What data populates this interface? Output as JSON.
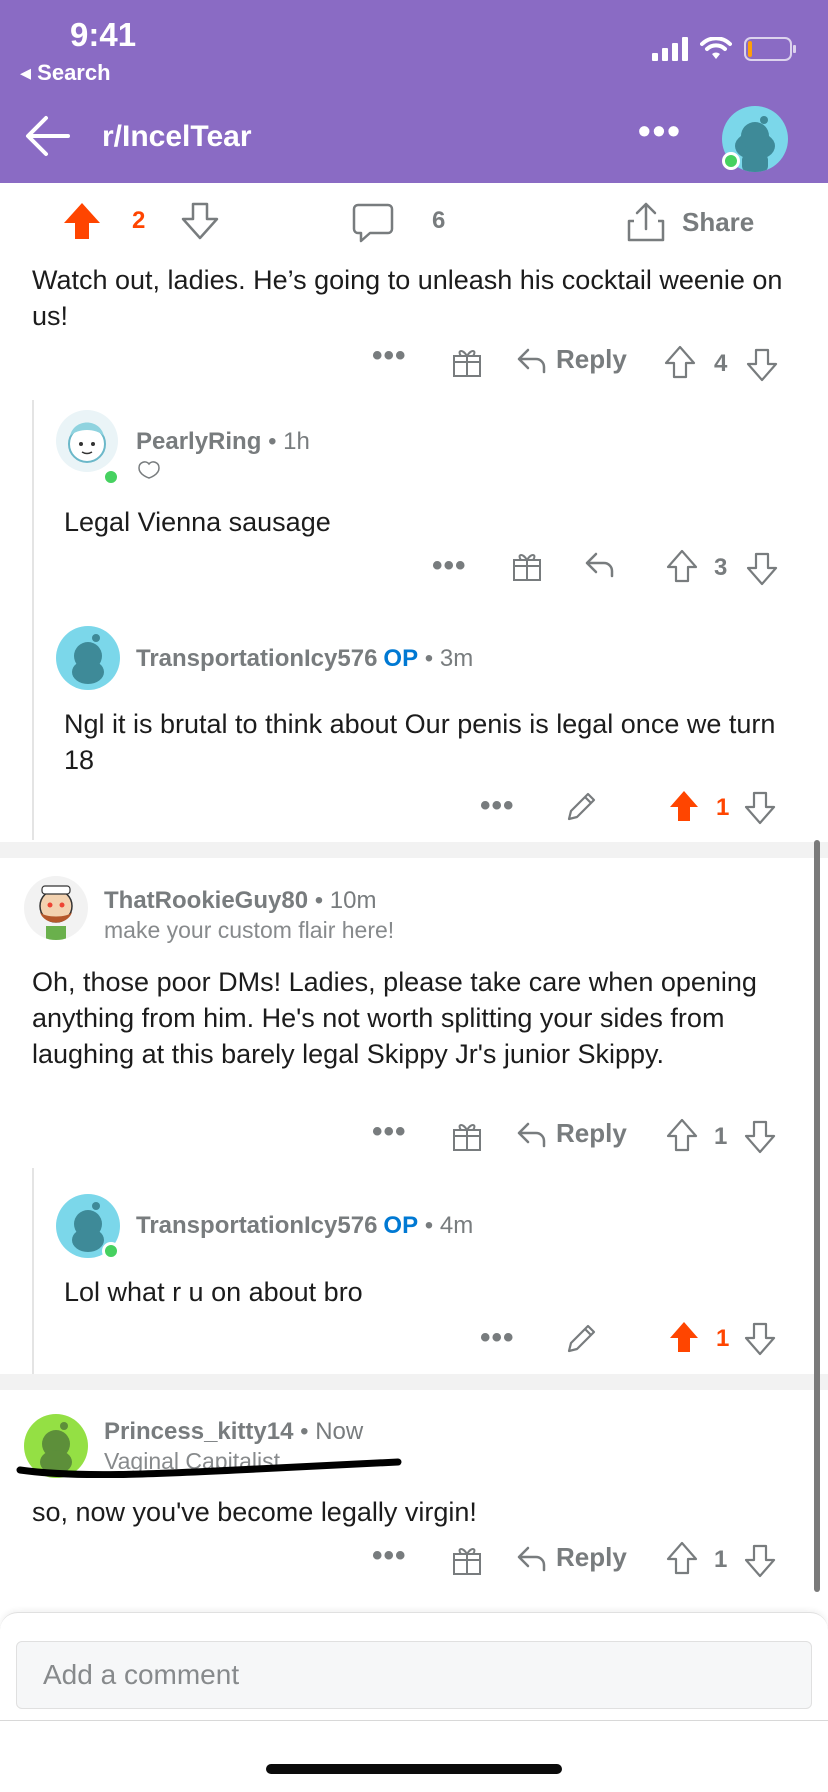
{
  "status_bar": {
    "time": "9:41",
    "back_app": "Search"
  },
  "header": {
    "subreddit": "r/IncelTear"
  },
  "post_actions": {
    "upvotes": "2",
    "comments": "6",
    "share_label": "Share"
  },
  "comments": {
    "c0": {
      "text": "Watch out, ladies. He’s going to unleash his cocktail weenie on us!",
      "reply_label": "Reply",
      "votes": "4"
    },
    "c1": {
      "username": "PearlyRing",
      "meta": "• 1h",
      "text": "Legal Vienna sausage",
      "votes": "3"
    },
    "c2": {
      "username": "TransportationIcy576",
      "op": "OP",
      "meta": "• 3m",
      "text": "Ngl it is brutal to think about Our penis is legal once we turn 18",
      "votes": "1"
    },
    "c3": {
      "username": "ThatRookieGuy80",
      "meta": "• 10m",
      "flair": "make your custom flair here!",
      "text": "Oh, those poor DMs! Ladies, please take care when opening anything from him. He's not worth splitting your sides from laughing at this barely legal Skippy Jr's junior Skippy.",
      "reply_label": "Reply",
      "votes": "1"
    },
    "c4": {
      "username": "TransportationIcy576",
      "op": "OP",
      "meta": "• 4m",
      "text": "Lol what r u on about bro",
      "votes": "1"
    },
    "c5": {
      "username": "Princess_kitty14",
      "meta": "• Now",
      "flair": "Vaginal Capitalist",
      "text": "so, now you've become legally virgin!",
      "reply_label": "Reply",
      "votes": "1"
    }
  },
  "comment_box": {
    "placeholder": "Add a comment"
  },
  "colors": {
    "header": "#8a6bc4",
    "upvote": "#ff4500",
    "op": "#0079d3",
    "online": "#46d160"
  },
  "icons": [
    "back-arrow-icon",
    "more-icon",
    "upvote-icon",
    "downvote-icon",
    "comment-icon",
    "share-icon",
    "gift-icon",
    "reply-icon",
    "edit-icon",
    "battery-icon",
    "wifi-icon",
    "signal-icon"
  ]
}
